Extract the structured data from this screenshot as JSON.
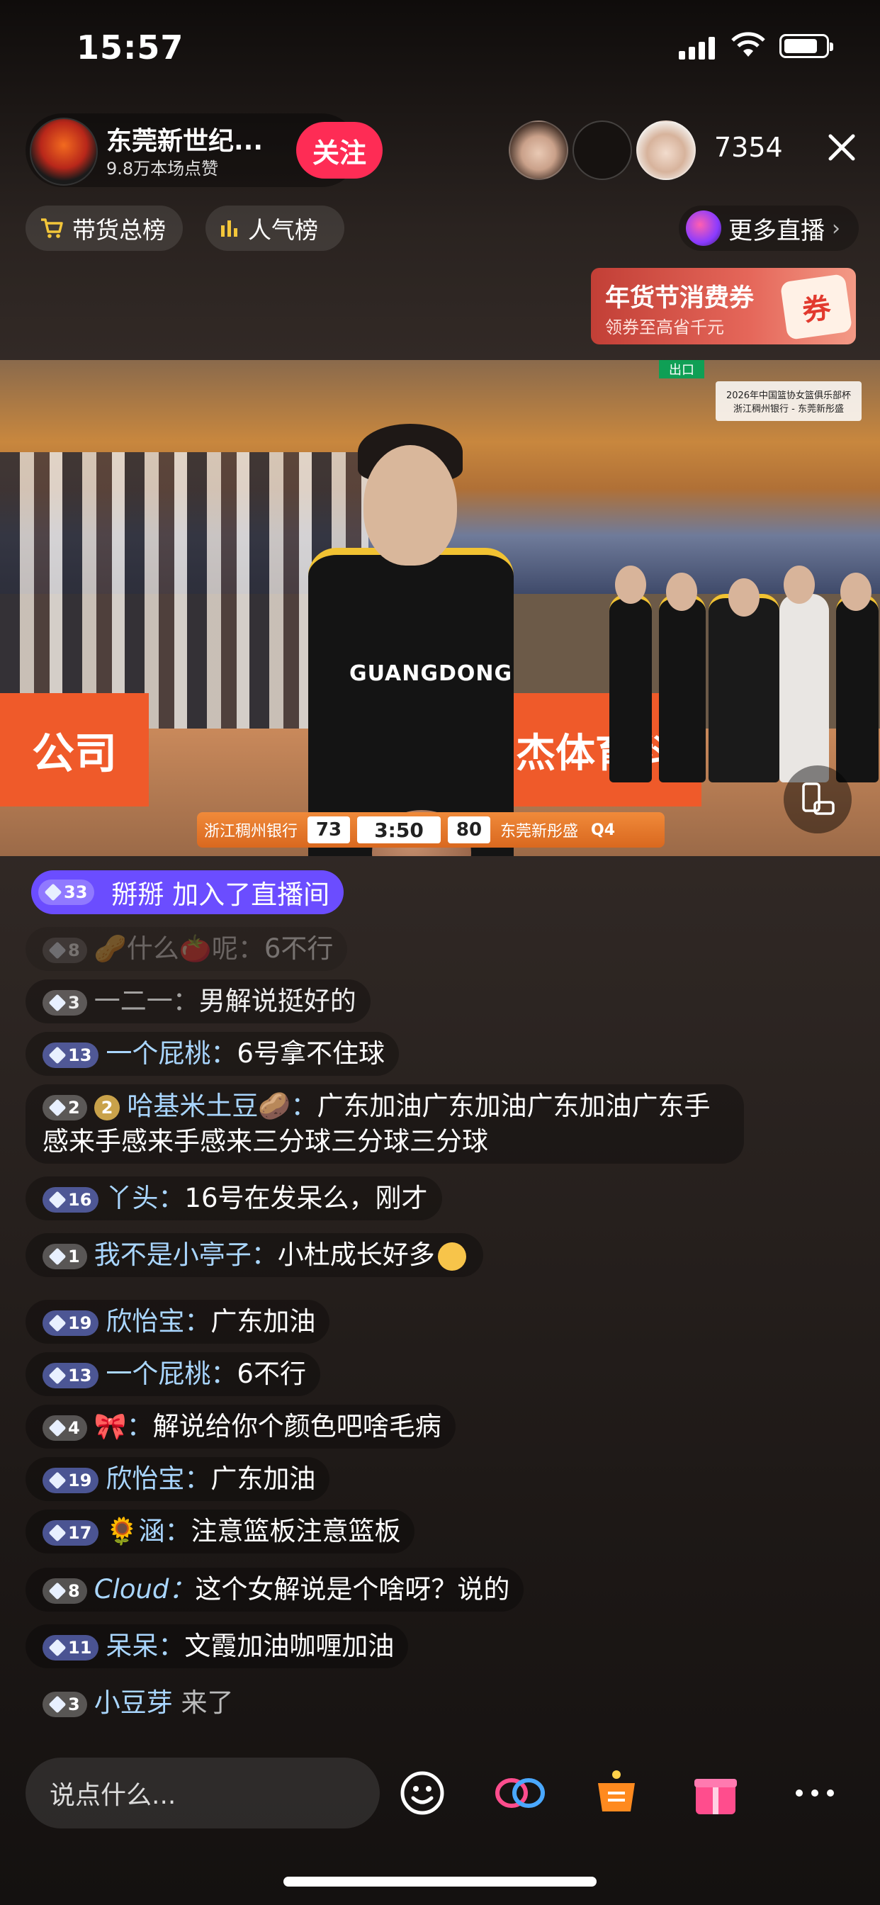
{
  "status_bar": {
    "time": "15:57"
  },
  "anchor": {
    "name": "东莞新世纪...",
    "likes": "9.8万本场点赞",
    "follow_label": "关注"
  },
  "viewers": {
    "count": "7354"
  },
  "tabs": {
    "sales_rank": "带货总榜",
    "popularity": "人气榜",
    "more_live": "更多直播"
  },
  "coupon": {
    "title": "年货节消费券",
    "subtitle": "领券至高省千元",
    "badge": "券"
  },
  "video": {
    "banner_left": "公司",
    "banner_right": "杰体育科",
    "exit_sign": "出口",
    "jersey_text": "GUANGDONG",
    "tv_logo_line1": "2026年中国篮协女篮俱乐部杯",
    "tv_logo_line2": "浙江稠州银行 - 东莞新彤盛",
    "scoreboard": {
      "home_team": "浙江稠州银行",
      "home_score": "73",
      "clock": "3:50",
      "away_score": "80",
      "away_team": "东莞新彤盛",
      "quarter": "Q4"
    }
  },
  "chat": {
    "join": {
      "level": "33",
      "text": "掰掰 加入了直播间"
    },
    "messages": [
      {
        "level": "8",
        "user": "🥜什么🍅呢：",
        "text": "6不行"
      },
      {
        "level": "3",
        "user": "一二一：",
        "text": "男解说挺好的"
      },
      {
        "level": "13",
        "user": "一个屁桃：",
        "text": "6号拿不住球"
      },
      {
        "level": "2",
        "badge": "2",
        "user": "哈基米土豆🥔：",
        "text": "广东加油广东加油广东加油广东手感来手感来手感来三分球三分球三分球"
      },
      {
        "level": "16",
        "user": "丫头：",
        "text": "16号在发呆么，刚才"
      },
      {
        "level": "1",
        "user": "我不是小亭子：",
        "text": "小杜成长好多"
      },
      {
        "level": "19",
        "user": "欣怡宝：",
        "text": "广东加油"
      },
      {
        "level": "13",
        "user": "一个屁桃：",
        "text": "6不行"
      },
      {
        "level": "4",
        "user": "🎀：",
        "text": "解说给你个颜色吧啥毛病"
      },
      {
        "level": "19",
        "user": "欣怡宝：",
        "text": "广东加油"
      },
      {
        "level": "17",
        "user": "🌻涵：",
        "text": "注意篮板注意篮板"
      },
      {
        "level": "8",
        "user": "Cloud：",
        "text": "这个女解说是个啥呀？说的"
      },
      {
        "level": "11",
        "user": "呆呆：",
        "text": "文霞加油咖喱加油"
      },
      {
        "level": "3",
        "user": "小豆芽",
        "text": "来了"
      }
    ]
  },
  "bottom_bar": {
    "input_placeholder": "说点什么..."
  },
  "icons": [
    "close-icon",
    "cart-icon",
    "bar-chart-icon",
    "chevron-right-icon",
    "rotate-screen-icon",
    "emoji-icon",
    "link-icon",
    "shopping-icon",
    "gift-icon",
    "more-icon"
  ],
  "colors": {
    "follow": "#fe2c55",
    "join_banner": "#6b4dff",
    "username": "#a9d6ff",
    "scoreboard": "#f08a3a"
  }
}
